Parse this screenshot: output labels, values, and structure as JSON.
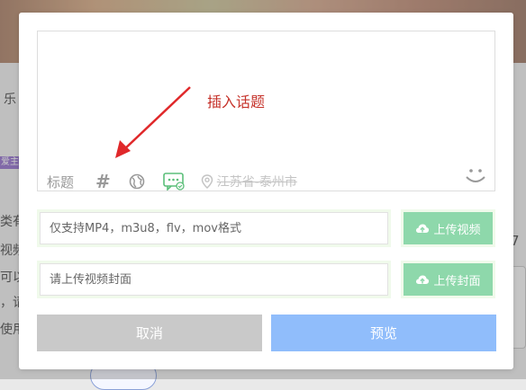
{
  "background": {
    "fragments": [
      "乐",
      "类有",
      "视频",
      "可以",
      "，请",
      "使用"
    ],
    "tag": "爱主",
    "side_value": "7"
  },
  "editor": {
    "toolbar": {
      "title_label": "标题",
      "hash_label": "#",
      "location_text": "江苏省-泰州市"
    },
    "annotation": "插入话题"
  },
  "video_upload": {
    "placeholder": "仅支持MP4，m3u8，flv，mov格式",
    "button_label": "上传视频"
  },
  "cover_upload": {
    "placeholder": "请上传视频封面",
    "button_label": "上传封面"
  },
  "actions": {
    "cancel_label": "取消",
    "preview_label": "预览"
  },
  "colors": {
    "annotation_red": "#c6332b",
    "green_accent": "#8ed8ab",
    "cancel_gray": "#c9c9c9",
    "preview_blue": "#90bdfb"
  }
}
